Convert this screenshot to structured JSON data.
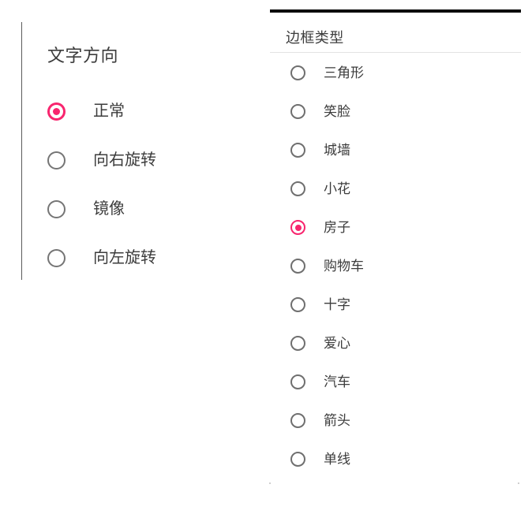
{
  "theme": {
    "accent_color": "#f8256e",
    "radio_unselected_color": "#757575",
    "text_color": "#3c3c3c",
    "rule_color": "#5c5c5c",
    "topbar_color": "#0a0a0a",
    "divider_color": "#e3e3e3",
    "background": "#ffffff"
  },
  "left_panel": {
    "header": "文字方向",
    "options": [
      {
        "label": "正常",
        "selected": true
      },
      {
        "label": "向右旋转",
        "selected": false
      },
      {
        "label": "镜像",
        "selected": false
      },
      {
        "label": "向左旋转",
        "selected": false
      }
    ]
  },
  "right_panel": {
    "header": "边框类型",
    "options": [
      {
        "label": "三角形",
        "selected": false
      },
      {
        "label": "笑脸",
        "selected": false
      },
      {
        "label": "城墙",
        "selected": false
      },
      {
        "label": "小花",
        "selected": false
      },
      {
        "label": "房子",
        "selected": true
      },
      {
        "label": "购物车",
        "selected": false
      },
      {
        "label": "十字",
        "selected": false
      },
      {
        "label": "爱心",
        "selected": false
      },
      {
        "label": "汽车",
        "selected": false
      },
      {
        "label": "箭头",
        "selected": false
      },
      {
        "label": "单线",
        "selected": false
      }
    ]
  }
}
